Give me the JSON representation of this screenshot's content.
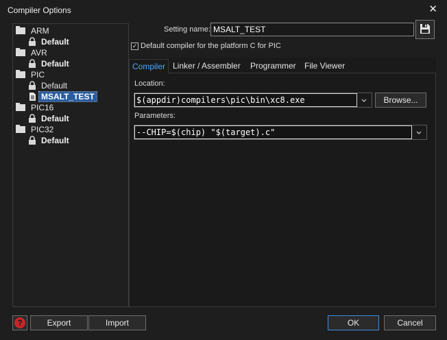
{
  "window": {
    "title": "Compiler Options",
    "close_glyph": "✕"
  },
  "tree": {
    "groups": [
      {
        "label": "ARM",
        "children": [
          {
            "label": "Default",
            "locked": true
          }
        ]
      },
      {
        "label": "AVR",
        "children": [
          {
            "label": "Default",
            "locked": true
          }
        ]
      },
      {
        "label": "PIC",
        "children": [
          {
            "label": "Default",
            "locked": true
          },
          {
            "label": "MSALT_TEST",
            "locked": false,
            "selected": true
          }
        ]
      },
      {
        "label": "PIC16",
        "children": [
          {
            "label": "Default",
            "locked": true
          }
        ]
      },
      {
        "label": "PIC32",
        "children": [
          {
            "label": "Default",
            "locked": true
          }
        ]
      }
    ]
  },
  "setting": {
    "label": "Setting name:",
    "value": "MSALT_TEST",
    "save_icon": "floppy-disk-icon",
    "default_checkbox": {
      "checked": true,
      "label": "Default compiler for the platform C for PIC"
    }
  },
  "tabs": [
    {
      "label": "Compiler",
      "active": true
    },
    {
      "label": "Linker / Assembler",
      "active": false
    },
    {
      "label": "Programmer",
      "active": false
    },
    {
      "label": "File Viewer",
      "active": false
    }
  ],
  "compiler": {
    "location_label": "Location:",
    "location_value": "$(appdir)compilers\\pic\\bin\\xc8.exe",
    "browse_label": "Browse...",
    "parameters_label": "Parameters:",
    "parameters_value": "--CHIP=$(chip) \"$(target).c\""
  },
  "footer": {
    "help_icon": "help-icon",
    "help_glyph": "?",
    "export_label": "Export",
    "import_label": "Import",
    "ok_label": "OK",
    "cancel_label": "Cancel"
  },
  "colors": {
    "background": "#1e1e1e",
    "active_tab": "#4fa3ff",
    "selection": "#2a5d9f",
    "help": "#c62828"
  }
}
